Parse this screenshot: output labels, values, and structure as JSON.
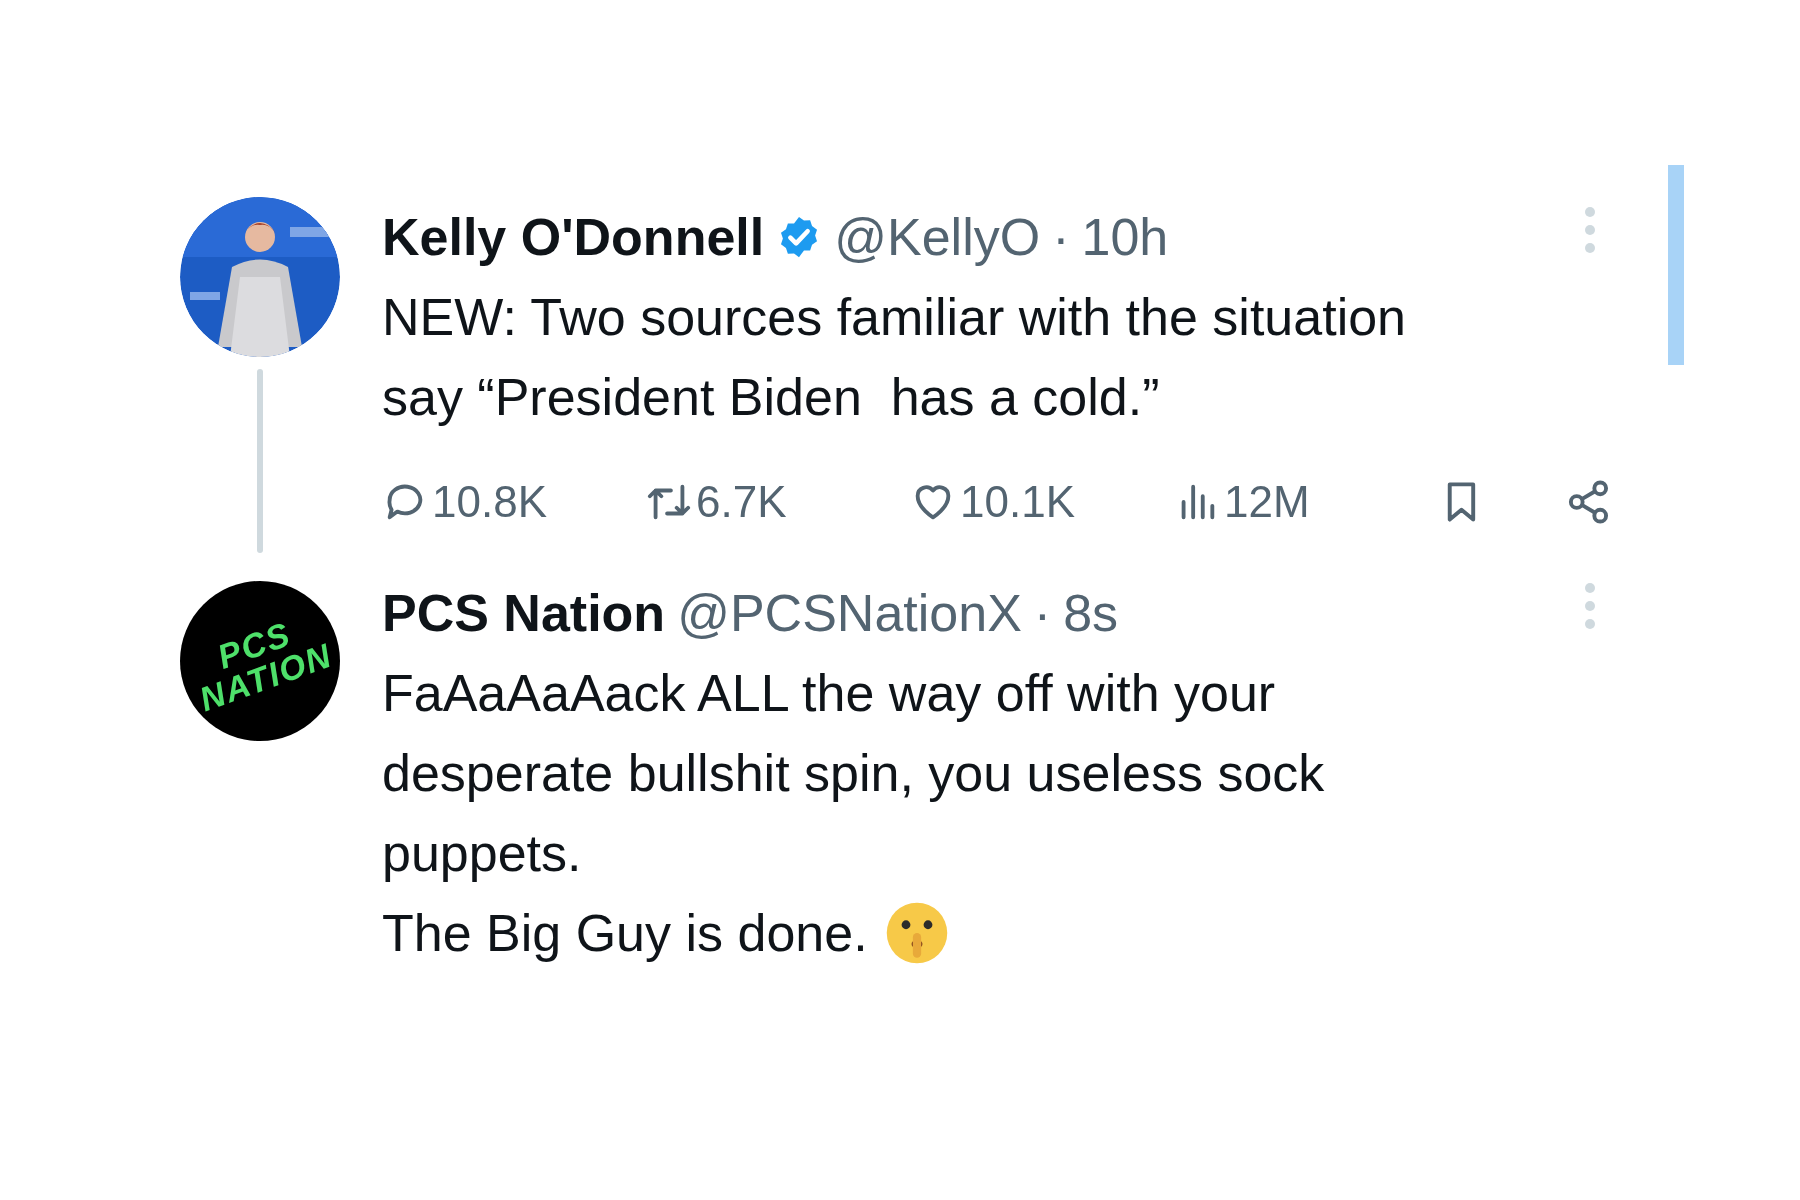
{
  "tweet": {
    "name": "Kelly O'Donnell",
    "verified": true,
    "handle": "@KellyO",
    "dot": "·",
    "time": "10h",
    "lines": [
      "NEW: Two sources familiar with the situation",
      "say “President Biden  has a cold.”"
    ],
    "stats": [
      {
        "kind": "reply",
        "count": "10.8K"
      },
      {
        "kind": "repost",
        "count": "6.7K"
      },
      {
        "kind": "like",
        "count": "10.1K"
      },
      {
        "kind": "views",
        "count": "12M"
      }
    ]
  },
  "reply": {
    "name": "PCS Nation",
    "verified": false,
    "handle": "@PCSNationX",
    "dot": "·",
    "time": "8s",
    "avatar": {
      "kind": "logo",
      "text": [
        "PCS",
        "NATION"
      ]
    },
    "lines": [
      "FaAaAaAack ALL the way off with your",
      "desperate bullshit spin, you useless sock",
      "puppets.",
      "The Big Guy is done."
    ]
  }
}
